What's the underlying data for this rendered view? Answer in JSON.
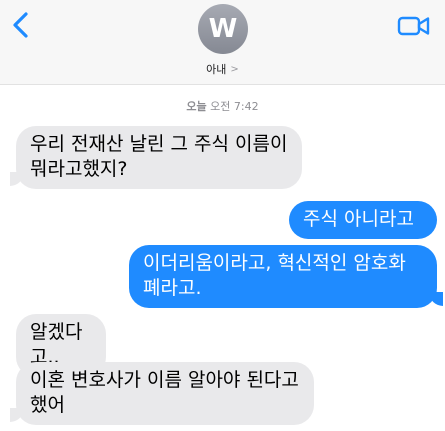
{
  "header": {
    "avatar_letter": "W",
    "contact_name": "아내",
    "contact_chevron": ">"
  },
  "icons": {
    "back": "chevron-left-icon",
    "video": "video-camera-icon"
  },
  "colors": {
    "accent": "#1f8bff",
    "incoming_bubble": "#e9e9eb",
    "header_bg": "#f7f7f7"
  },
  "conversation": {
    "timestamp_day": "오늘",
    "timestamp_time": "오전 7:42",
    "messages": [
      {
        "direction": "incoming",
        "text": "우리 전재산 날린 그 주식 이름이\n뭐라고했지?"
      },
      {
        "direction": "outgoing",
        "text": "주식 아니라고"
      },
      {
        "direction": "outgoing",
        "text": "이더리움이라고, 혁신적인 암호화\n폐라고."
      },
      {
        "direction": "incoming",
        "text": "알겠다고.."
      },
      {
        "direction": "incoming",
        "text": "이혼 변호사가 이름 알아야 된다고\n했어"
      }
    ]
  }
}
